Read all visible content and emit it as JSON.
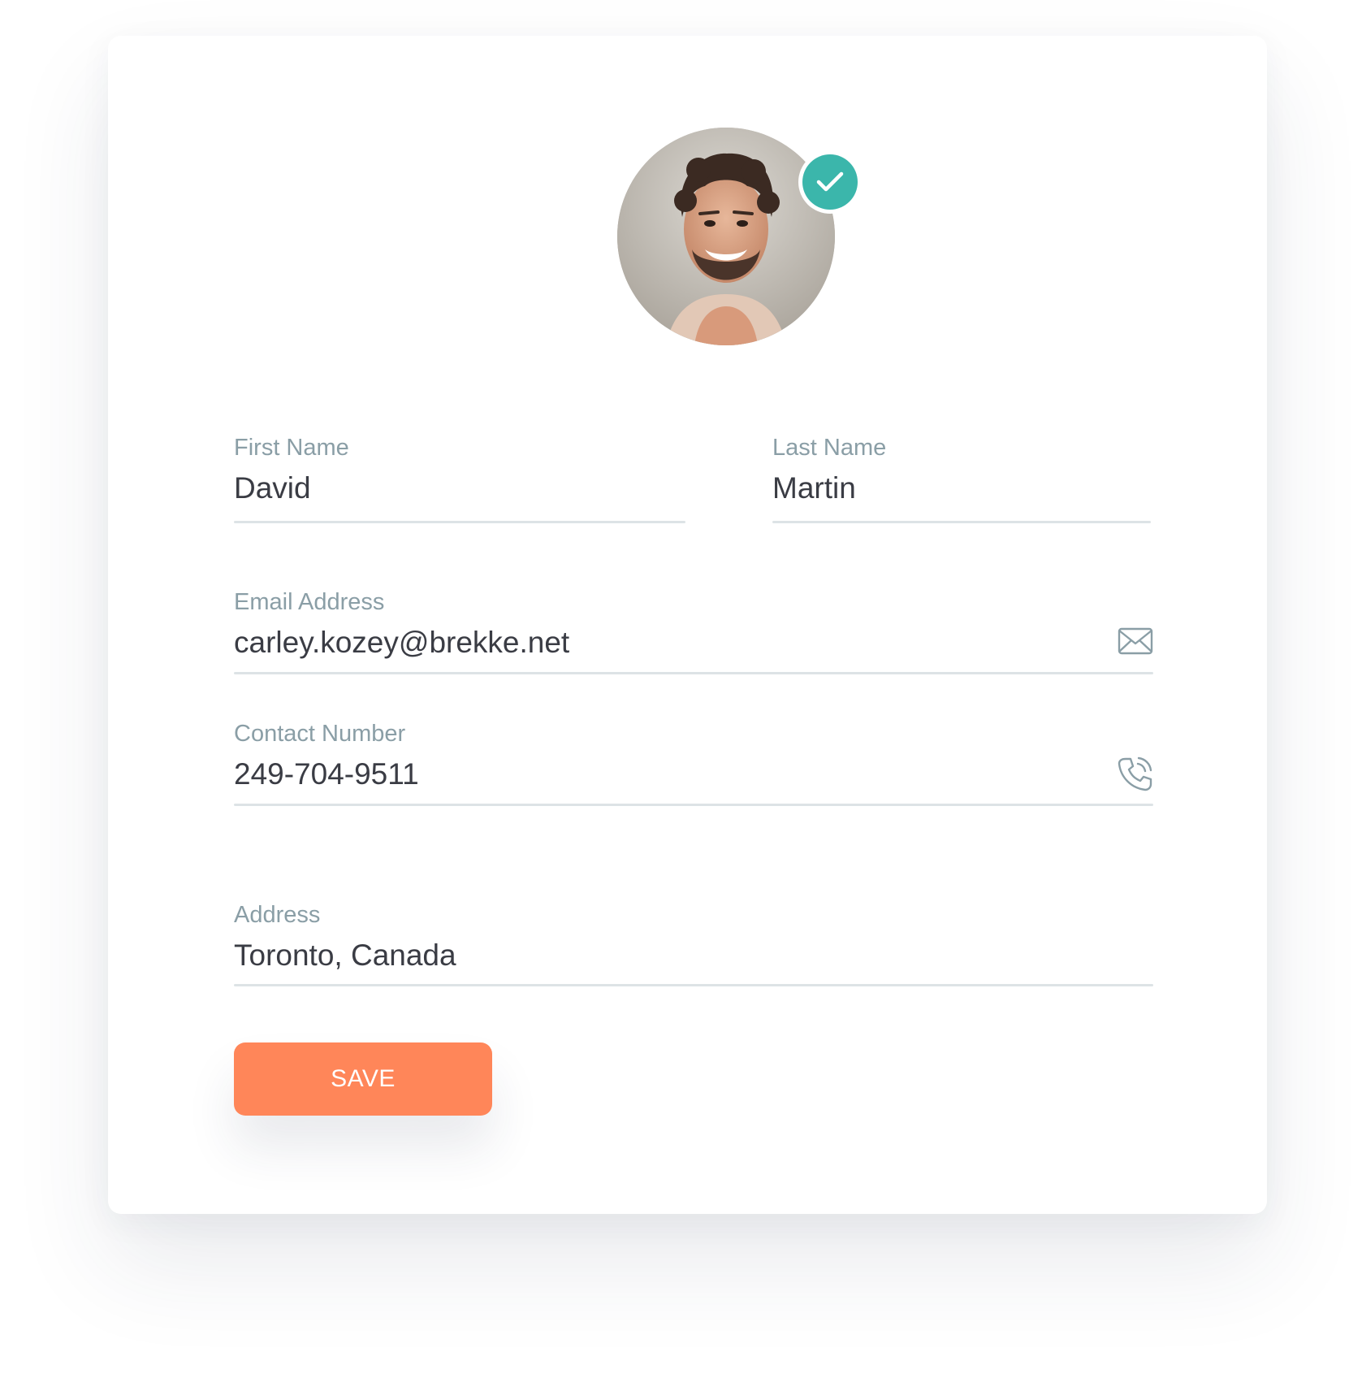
{
  "profile": {
    "avatar_icon": "person-photo",
    "verified_icon": "check-icon",
    "accent_color": "#3bb6ab"
  },
  "form": {
    "first_name": {
      "label": "First Name",
      "value": "David"
    },
    "last_name": {
      "label": "Last Name",
      "value": "Martin"
    },
    "email": {
      "label": "Email Address",
      "value": "carley.kozey@brekke.net",
      "icon": "mail-icon"
    },
    "contact": {
      "label": "Contact Number",
      "value": "249-704-9511",
      "icon": "phone-icon"
    },
    "address": {
      "label": "Address",
      "value": "Toronto, Canada"
    }
  },
  "actions": {
    "save_label": "SAVE",
    "save_color": "#ff8659"
  }
}
